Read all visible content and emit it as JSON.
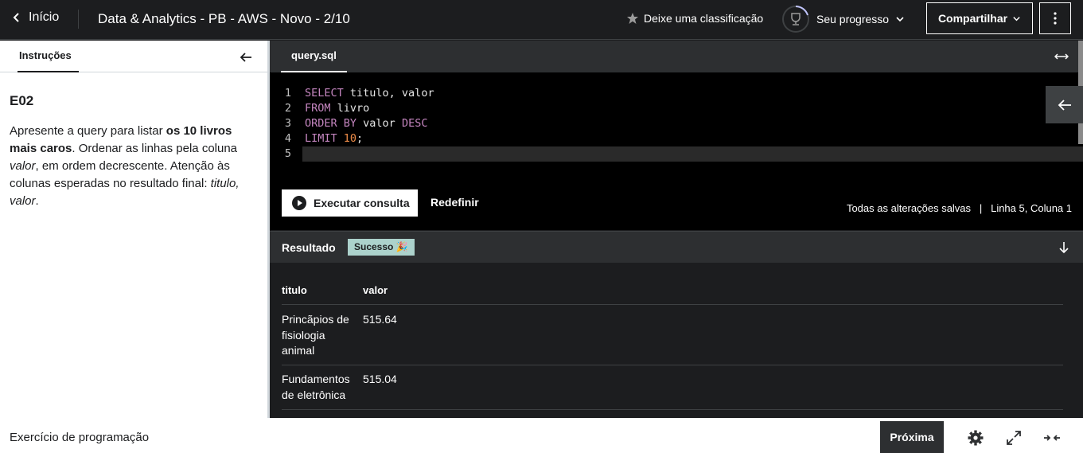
{
  "topbar": {
    "back_label": "Início",
    "course_title": "Data & Analytics - PB - AWS - Novo - 2/10",
    "rate_label": "Deixe uma classificação",
    "progress_label": "Seu progresso",
    "share_label": "Compartilhar"
  },
  "instructions": {
    "tab_label": "Instruções",
    "exercise_title": "E02",
    "desc_parts": {
      "p1": "Apresente a query para listar ",
      "b1": "os 10 livros mais caros",
      "p2": ". Ordenar as linhas pela coluna ",
      "i1": "valor",
      "p3": ", em ordem decrescente.  Atenção às colunas esperadas no resultado final: ",
      "i2": "titulo, valor",
      "p4": "."
    }
  },
  "editor": {
    "file_name": "query.sql",
    "line_numbers": [
      "1",
      "2",
      "3",
      "4",
      "5"
    ],
    "code": {
      "l1_kw": "SELECT",
      "l1_rest": " titulo, valor",
      "l2_kw": "FROM",
      "l2_rest": " livro",
      "l3_kw": "ORDER BY",
      "l3_mid": " valor ",
      "l3_kw2": "DESC",
      "l4_kw": "LIMIT",
      "l4_sp": " ",
      "l4_num": "10",
      "l4_end": ";"
    },
    "run_label": "Executar consulta",
    "reset_label": "Redefinir",
    "status_text": "Todas as alterações salvas   |   Linha 5, Coluna 1"
  },
  "result": {
    "title": "Resultado",
    "badge": "Sucesso 🎉",
    "columns": [
      "titulo",
      "valor"
    ],
    "rows": [
      {
        "titulo": "Princãpios de fisiologia animal",
        "valor": "515.64"
      },
      {
        "titulo": "Fundamentos de eletrônica",
        "valor": "515.04"
      }
    ]
  },
  "footer": {
    "label": "Exercício de programação",
    "next_label": "Próxima"
  }
}
